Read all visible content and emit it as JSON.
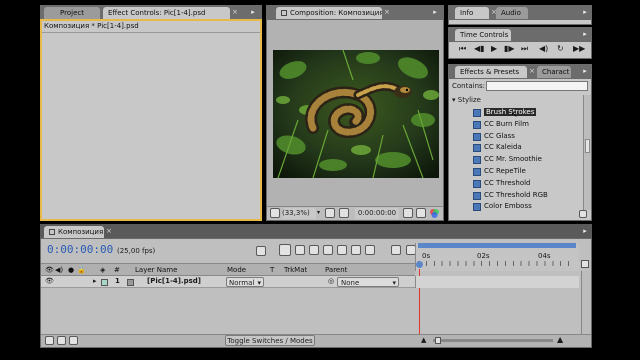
{
  "left_panel": {
    "tabs": [
      "Project",
      "Effect Controls: Pic[1-4].psd"
    ],
    "breadcrumb": "Композиция * Pic[1-4].psd"
  },
  "comp_panel": {
    "tab": "Composition: Композиция",
    "zoom": "(33,3%)",
    "timecode": "0:00:00:00"
  },
  "info_panel": {
    "tabs": [
      "Info",
      "Audio"
    ]
  },
  "time_controls": {
    "tab": "Time Controls"
  },
  "effects_panel": {
    "tabs": [
      "Effects & Presets",
      "Charact"
    ],
    "contains_label": "Contains:",
    "contains_value": "",
    "category": "Stylize",
    "items": [
      "Brush Strokes",
      "CC Burn Film",
      "CC Glass",
      "CC Kaleida",
      "CC Mr. Smoothie",
      "CC RepeTile",
      "CC Threshold",
      "CC Threshold RGB",
      "Color Emboss"
    ],
    "selected_index": 0
  },
  "timeline": {
    "tab": "Композиция",
    "timecode": "0:00:00:00",
    "fps": "(25,00 fps)",
    "columns": {
      "num": "#",
      "layer_name": "Layer Name",
      "mode": "Mode",
      "t": "T",
      "trkmat": "TrkMat",
      "parent": "Parent"
    },
    "ruler": [
      "0s",
      "02s",
      "04s"
    ],
    "playhead_fraction": 0.0,
    "layer": {
      "num": "1",
      "name": "[Pic[1-4].psd]",
      "mode": "Normal",
      "parent": "None"
    },
    "toggle_label": "Toggle Switches / Modes"
  },
  "colors": {
    "panel_bg": "#c8c8c8",
    "tabbar_bg": "#6c6c6c",
    "focus_border": "#e8b94a",
    "timecode_blue": "#2a5bb5",
    "playhead": "#e0362b",
    "work_area": "#5b86c9"
  }
}
